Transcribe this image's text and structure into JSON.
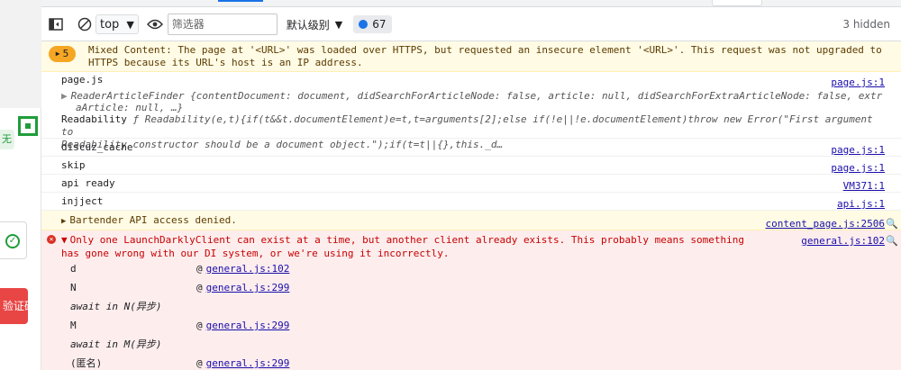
{
  "page": {
    "left_tag_text": "无",
    "left_red_button": "验证码"
  },
  "toolbar": {
    "context": "top",
    "filter_placeholder": "筛选器",
    "levels_label": "默认级别",
    "message_count": "67",
    "hidden_label": "3 hidden"
  },
  "console": {
    "mixed_content": {
      "count": "5",
      "text_line1": "Mixed Content: The page at '<URL>' was loaded over HTTPS, but requested an insecure element '<URL>'. This request was not upgraded to",
      "text_line2": "HTTPS because its URL's host is an IP address."
    },
    "pagejs_log": {
      "label": "page.js",
      "source": "page.js:1",
      "object_line1": "ReaderArticleFinder {contentDocument: document, didSearchForArticleNode: false, article: null, didSearchForExtraArticleNode: false, extr",
      "object_line2": "aArticle: null, …}",
      "readability_label": "Readability",
      "readability_line1": "ƒ Readability(e,t){if(t&&t.documentElement)e=t,t=arguments[2];else if(!e||!e.documentElement)throw new Error(\"First argument to",
      "readability_line2": "Readability constructor should be a document object.\");if(t=t||{},this._d…"
    },
    "simple_logs": [
      {
        "text": "discuz_cache",
        "source": "page.js:1"
      },
      {
        "text": "skip",
        "source": "page.js:1"
      },
      {
        "text": "api ready",
        "source": "VM371:1"
      },
      {
        "text": "injject",
        "source": "api.js:1"
      }
    ],
    "bartender": {
      "text": "Bartender API access denied.",
      "source": "content_page.js:2506"
    },
    "error": {
      "line1": "Only one LaunchDarklyClient can exist at a time, but another client already exists.  This probably means something",
      "line2": "has gone wrong with our DI system, or we're using it incorrectly.",
      "source": "general.js:102",
      "stack": [
        {
          "fn": "d",
          "at": "@",
          "link": "general.js:102"
        },
        {
          "fn": "N",
          "at": "@",
          "link": "general.js:299"
        },
        {
          "async": "await in N(异步)"
        },
        {
          "fn": "M",
          "at": "@",
          "link": "general.js:299"
        },
        {
          "async": "await in M(异步)"
        },
        {
          "fn": "(匿名)",
          "at": "@",
          "link": "general.js:299"
        }
      ]
    }
  }
}
